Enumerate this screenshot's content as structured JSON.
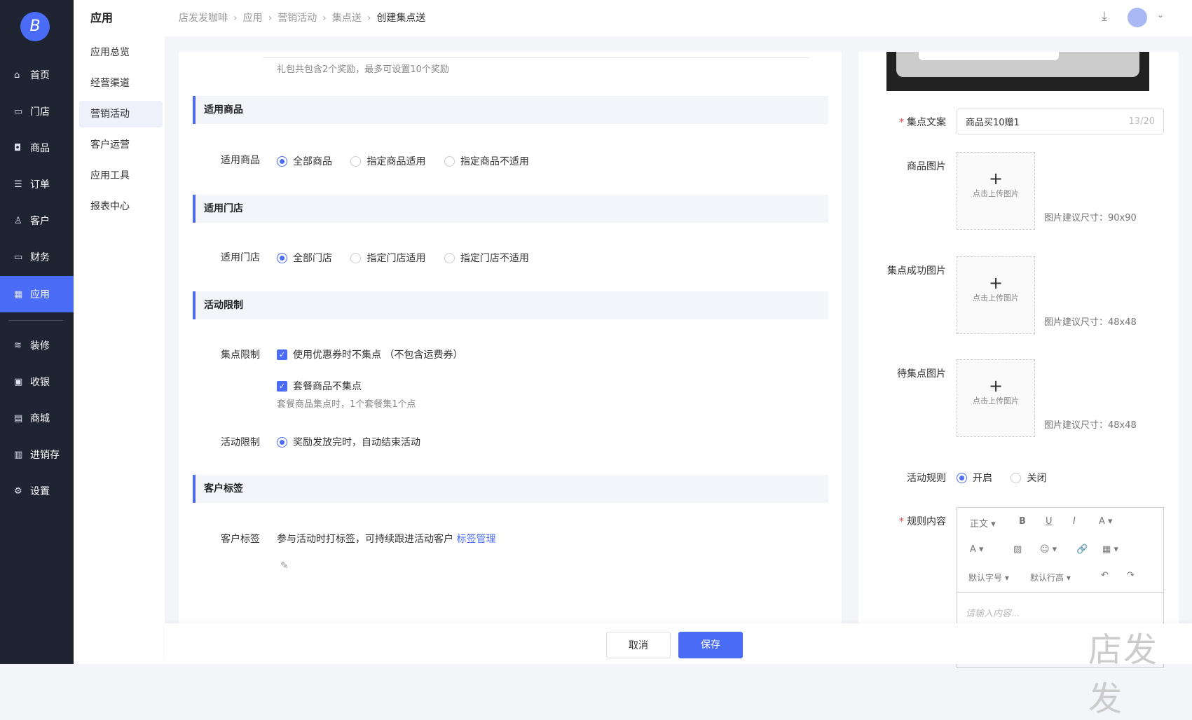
{
  "sidebar": {
    "logo": "B",
    "items": [
      {
        "label": "首页",
        "icon": "home-icon",
        "glyph": "⌂"
      },
      {
        "label": "门店",
        "icon": "store-icon",
        "glyph": "▭"
      },
      {
        "label": "商品",
        "icon": "bag-icon",
        "glyph": "◘"
      },
      {
        "label": "订单",
        "icon": "order-icon",
        "glyph": "☰"
      },
      {
        "label": "客户",
        "icon": "user-icon",
        "glyph": "♙"
      },
      {
        "label": "财务",
        "icon": "card-icon",
        "glyph": "▭"
      },
      {
        "label": "应用",
        "icon": "apps-icon",
        "glyph": "▦"
      },
      {
        "label": "装修",
        "icon": "layers-icon",
        "glyph": "≋"
      },
      {
        "label": "收银",
        "icon": "cashier-icon",
        "glyph": "▣"
      },
      {
        "label": "商城",
        "icon": "mall-icon",
        "glyph": "▤"
      },
      {
        "label": "进销存",
        "icon": "inventory-icon",
        "glyph": "▥"
      },
      {
        "label": "设置",
        "icon": "settings-icon",
        "glyph": "⚙"
      }
    ]
  },
  "subnav": {
    "title": "应用",
    "items": [
      "应用总览",
      "经营渠道",
      "营销活动",
      "客户运营",
      "应用工具",
      "报表中心"
    ]
  },
  "breadcrumb": [
    "店发发咖啡",
    "应用",
    "营销活动",
    "集点送",
    "创建集点送"
  ],
  "main": {
    "gift_hint": "礼包共包含2个奖励，最多可设置10个奖励",
    "sec_goods": "适用商品",
    "goods_label": "适用商品",
    "goods_opts": [
      "全部商品",
      "指定商品适用",
      "指定商品不适用"
    ],
    "sec_store": "适用门店",
    "store_label": "适用门店",
    "store_opts": [
      "全部门店",
      "指定门店适用",
      "指定门店不适用"
    ],
    "sec_limit": "活动限制",
    "point_limit_label": "集点限制",
    "cb1": "使用优惠券时不集点 （不包含运费券）",
    "cb2": "套餐商品不集点",
    "cb2_hint": "套餐商品集点时，1个套餐集1个点",
    "act_limit_label": "活动限制",
    "act_limit_opt": "奖励发放完时，自动结束活动",
    "sec_tag": "客户标签",
    "tag_label": "客户标签",
    "tag_text": "参与活动时打标签，可持续跟进活动客户",
    "tag_link": "标签管理"
  },
  "right": {
    "copy_label": "集点文案",
    "copy_value": "商品买10赠1",
    "copy_count": "13/20",
    "uploads": [
      {
        "label": "商品图片",
        "text": "点击上传图片",
        "hint": "图片建议尺寸：90x90"
      },
      {
        "label": "集点成功图片",
        "text": "点击上传图片",
        "hint": "图片建议尺寸：48x48"
      },
      {
        "label": "待集点图片",
        "text": "点击上传图片",
        "hint": "图片建议尺寸：48x48"
      }
    ],
    "rule_label": "活动规则",
    "rule_on": "开启",
    "rule_off": "关闭",
    "content_label": "规则内容",
    "editor": {
      "para": "正文 ▾",
      "bold": "B",
      "underline": "U",
      "italic": "I",
      "color": "A ▾",
      "bg": "A ▾",
      "image": "▨",
      "emoji": "☺ ▾",
      "link": "🔗",
      "table": "▦ ▾",
      "fontsize": "默认字号 ▾",
      "lineheight": "默认行高 ▾",
      "undo": "↶",
      "redo": "↷",
      "placeholder": "请输入内容..."
    }
  },
  "footer": {
    "cancel": "取消",
    "save": "保存"
  },
  "watermark": "店发发",
  "colors": {
    "primary": "#4a6cf7",
    "sidebar": "#1f2433"
  }
}
